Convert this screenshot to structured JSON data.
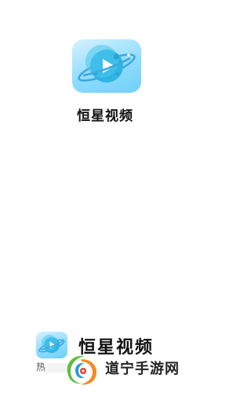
{
  "app": {
    "icon": "planet-play-icon",
    "name": "恒星视频"
  },
  "brand": {
    "icon": "planet-play-icon",
    "name": "恒星视频",
    "cut_label": "热"
  },
  "watermark": {
    "logo": "daoning-logo-icon",
    "text": "道宁手游网"
  },
  "colors": {
    "icon_bg_light": "#d6f2ff",
    "icon_bg_mid": "#8fdcff",
    "planet": "#2fb3e3",
    "ring": "#3aa8de",
    "play": "#ffffff"
  }
}
